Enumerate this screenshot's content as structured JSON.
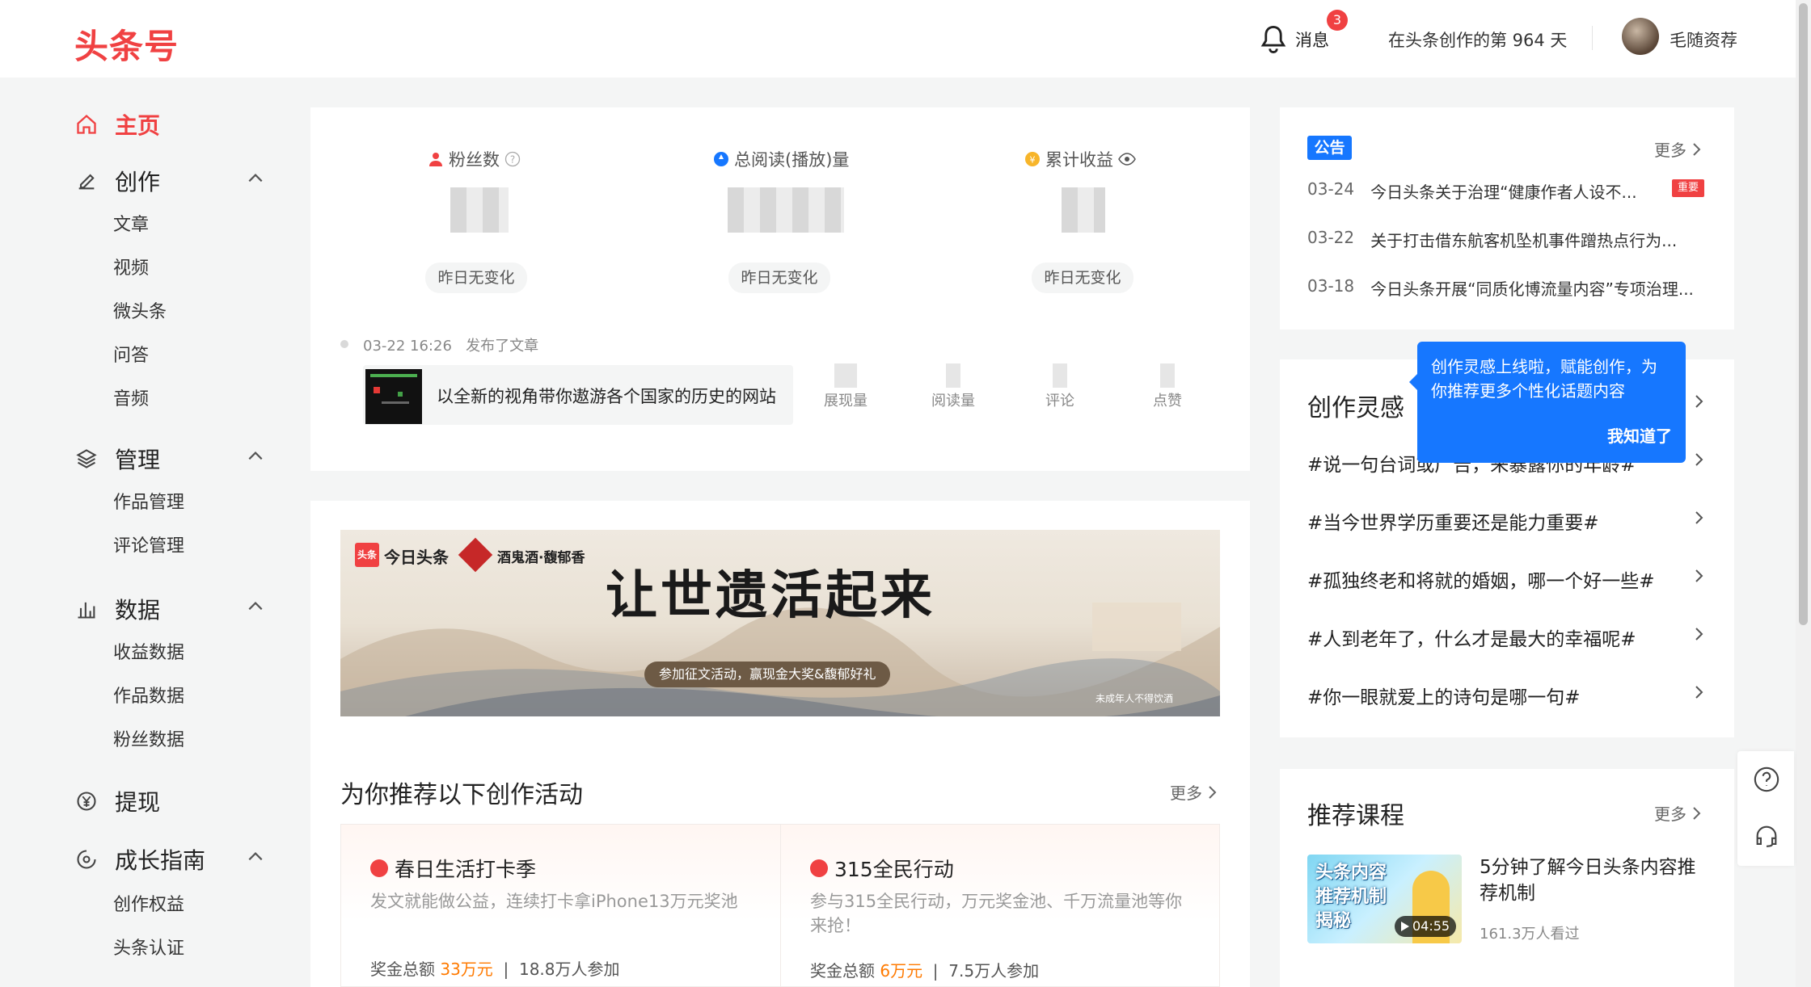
{
  "header": {
    "logo": "头条号",
    "messages_label": "消息",
    "messages_count": "3",
    "days_text": "在头条创作的第 964 天",
    "username": "毛随资荐"
  },
  "sidebar": {
    "home": "主页",
    "create": {
      "label": "创作",
      "items": [
        "文章",
        "视频",
        "微头条",
        "问答",
        "音频"
      ]
    },
    "manage": {
      "label": "管理",
      "items": [
        "作品管理",
        "评论管理"
      ]
    },
    "data": {
      "label": "数据",
      "items": [
        "收益数据",
        "作品数据",
        "粉丝数据"
      ]
    },
    "withdraw": "提现",
    "growth": {
      "label": "成长指南",
      "items": [
        "创作权益",
        "头条认证"
      ]
    }
  },
  "stats": {
    "fans_label": "粉丝数",
    "reads_label": "总阅读(播放)量",
    "income_label": "累计收益",
    "change_text": "昨日无变化"
  },
  "recent": {
    "time": "03-22 16:26",
    "action": "发布了文章",
    "title": "以全新的视角带你遨游各个国家的历史的网站",
    "metrics": [
      "展现量",
      "阅读量",
      "评论",
      "点赞"
    ]
  },
  "banner": {
    "brand1": "今日头条",
    "brand2": "酒鬼酒·馥郁香",
    "headline": "让世遗活起来",
    "sub": "参加征文活动，赢现金大奖&馥郁好礼",
    "disclaimer": "未成年人不得饮酒",
    "logo_badge": "头条"
  },
  "activities": {
    "title": "为你推荐以下创作活动",
    "more": "更多",
    "items": [
      {
        "title": "春日生活打卡季",
        "desc": "发文就能做公益，连续打卡拿iPhone13万元奖池",
        "prize_label": "奖金总额",
        "prize": "33万元",
        "participants": "18.8万人参加"
      },
      {
        "title": "315全民行动",
        "desc": "参与315全民行动，万元奖金池、千万流量池等你来抢！",
        "prize_label": "奖金总额",
        "prize": "6万元",
        "participants": "7.5万人参加"
      }
    ]
  },
  "notice": {
    "tag": "公告",
    "more": "更多",
    "hot_tag": "重要",
    "rows": [
      {
        "date": "03-24",
        "text": "今日头条关于治理“健康作者人设不..."
      },
      {
        "date": "03-22",
        "text": "关于打击借东航客机坠机事件蹭热点行为..."
      },
      {
        "date": "03-18",
        "text": "今日头条开展“同质化博流量内容”专项治理..."
      }
    ]
  },
  "inspiration": {
    "title": "创作灵感",
    "topics": [
      "#说一句台词或广告，来暴露你的年龄#",
      "#当今世界学历重要还是能力重要#",
      "#孤独终老和将就的婚姻，哪一个好一些#",
      "#人到老年了，什么才是最大的幸福呢#",
      "#你一眼就爱上的诗句是哪一句#"
    ],
    "tooltip_text": "创作灵感上线啦，赋能创作，为你推荐更多个性化话题内容",
    "tooltip_ok": "我知道了"
  },
  "courses": {
    "title": "推荐课程",
    "more": "更多",
    "item_title": "5分钟了解今日头条内容推荐机制",
    "item_views": "161.3万人看过",
    "thumb_text": "头条内容推荐机制揭秘",
    "duration": "04:55"
  },
  "colors": {
    "brand": "#f04142",
    "accent": "#1677ff",
    "highlight": "#ff7a00"
  }
}
